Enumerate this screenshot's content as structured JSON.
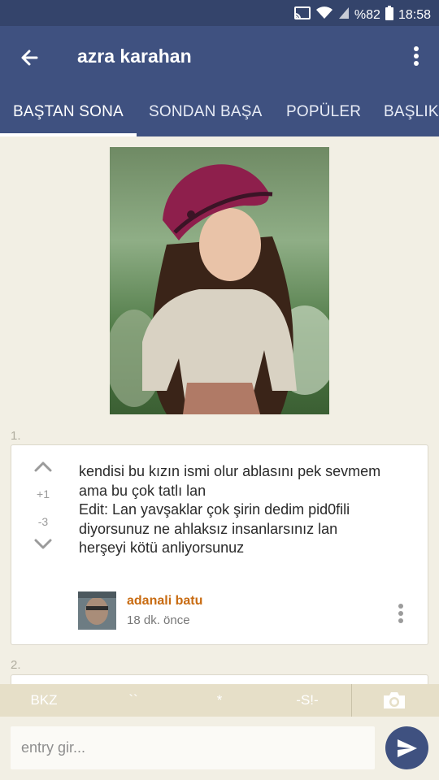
{
  "status_bar": {
    "battery_text": "%82",
    "time": "18:58"
  },
  "app_bar": {
    "title": "azra karahan",
    "tabs": [
      {
        "label": "BAŞTAN SONA",
        "active": true
      },
      {
        "label": "SONDAN BAŞA",
        "active": false
      },
      {
        "label": "POPÜLER",
        "active": false
      },
      {
        "label": "BAŞLIK",
        "active": false
      }
    ]
  },
  "entries": [
    {
      "number": "1.",
      "upvotes": "+1",
      "downvotes": "-3",
      "lines": [
        "kendisi bu kızın ismi olur ablasını pek sevmem",
        "ama bu çok tatlı lan",
        "Edit: Lan yavşaklar çok şirin dedim pid0fili",
        "diyorsunuz ne ahlaksız insanlarsınız lan",
        "herşeyi kötü anliyorsunuz"
      ],
      "author": "adanali batu",
      "time": "18 dk. önce"
    },
    {
      "number": "2."
    }
  ],
  "shortcut_bar": {
    "bkz": "BKZ",
    "backticks": "``",
    "asterisk": "*",
    "spoiler": "-S!-"
  },
  "input_bar": {
    "placeholder": "entry gir..."
  },
  "colors": {
    "status_bar": "#34446b",
    "app_bar": "#3f5180",
    "background": "#f2efe4",
    "author": "#c86b11",
    "shortcut_bar": "#e6dfc8"
  },
  "icons": [
    "back-arrow-icon",
    "overflow-menu-icon",
    "upvote-icon",
    "downvote-icon",
    "camera-icon",
    "send-icon",
    "cast-icon",
    "wifi-icon",
    "signal-icon",
    "battery-icon"
  ]
}
